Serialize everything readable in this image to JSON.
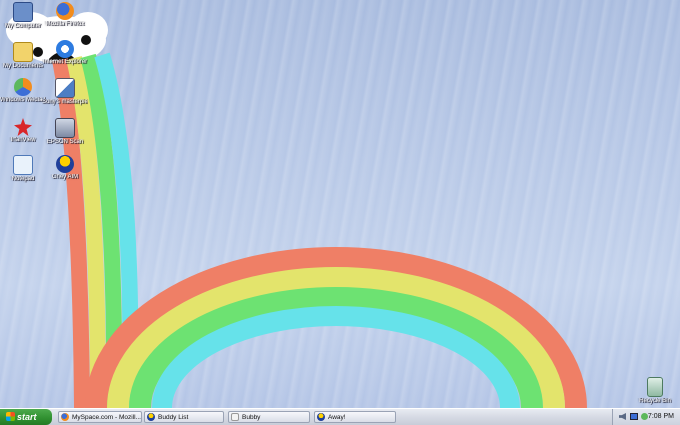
{
  "desktop": {
    "icons": [
      {
        "label": "My Computer",
        "icon": "my-computer-icon"
      },
      {
        "label": "Mozilla Firefox",
        "icon": "firefox-icon"
      },
      {
        "label": "My Documents",
        "icon": "my-documents-icon"
      },
      {
        "label": "Internet Explorer",
        "icon": "internet-explorer-icon"
      },
      {
        "label": "Windows Media Player",
        "icon": "media-player-icon"
      },
      {
        "label": "Sony's masterpiece",
        "icon": "paint-icon"
      },
      {
        "label": "IrfanView",
        "icon": "irfanview-icon"
      },
      {
        "label": "EPSON Scan",
        "icon": "scanner-icon"
      },
      {
        "label": "Notepad",
        "icon": "notepad-icon"
      },
      {
        "label": "Ghey AIM",
        "icon": "aim-icon"
      }
    ],
    "recycle_bin": {
      "label": "Recycle Bin",
      "icon": "recycle-bin-icon"
    }
  },
  "taskbar": {
    "start_label": "start",
    "tasks": [
      {
        "label": "MySpace.com - Mozill...",
        "icon": "firefox-icon"
      },
      {
        "label": "Buddy List",
        "icon": "aim-icon"
      },
      {
        "label": "Bubby",
        "icon": "chat-icon"
      },
      {
        "label": "Away!",
        "icon": "aim-icon"
      }
    ],
    "clock": "7:08 PM"
  },
  "colors": {
    "rainbow": [
      "#ef7f66",
      "#e3e46c",
      "#6de272",
      "#66e2ea"
    ],
    "start_green": "#2f8f2f"
  }
}
